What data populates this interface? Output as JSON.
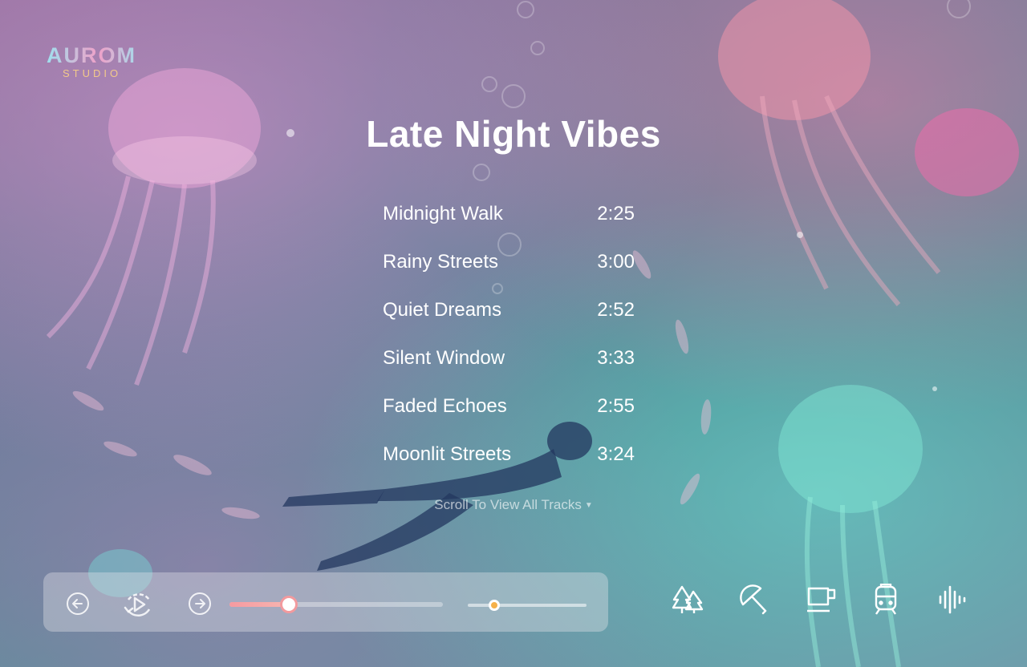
{
  "brand": {
    "logo_main": "AUROM",
    "logo_sub": "STUDIO"
  },
  "playlist": {
    "title": "Late Night Vibes",
    "tracks": [
      {
        "name": "Midnight Walk",
        "duration": "2:25"
      },
      {
        "name": "Rainy Streets",
        "duration": "3:00"
      },
      {
        "name": "Quiet Dreams",
        "duration": "2:52"
      },
      {
        "name": "Silent Window",
        "duration": "3:33"
      },
      {
        "name": "Faded Echoes",
        "duration": "2:55"
      },
      {
        "name": "Moonlit Streets",
        "duration": "3:24"
      }
    ],
    "scroll_hint": "Scroll To View All Tracks"
  },
  "player": {
    "buttons": [
      "previous-icon",
      "replay-play-icon",
      "next-icon"
    ],
    "progress_fraction": 0.28,
    "volume_fraction": 0.22,
    "accent_color": "#f29a9e",
    "volume_color": "#f6b14a"
  },
  "ambient_sounds": [
    "forest-icon",
    "umbrella-rain-icon",
    "coffee-cup-icon",
    "train-icon",
    "sound-wave-icon"
  ]
}
